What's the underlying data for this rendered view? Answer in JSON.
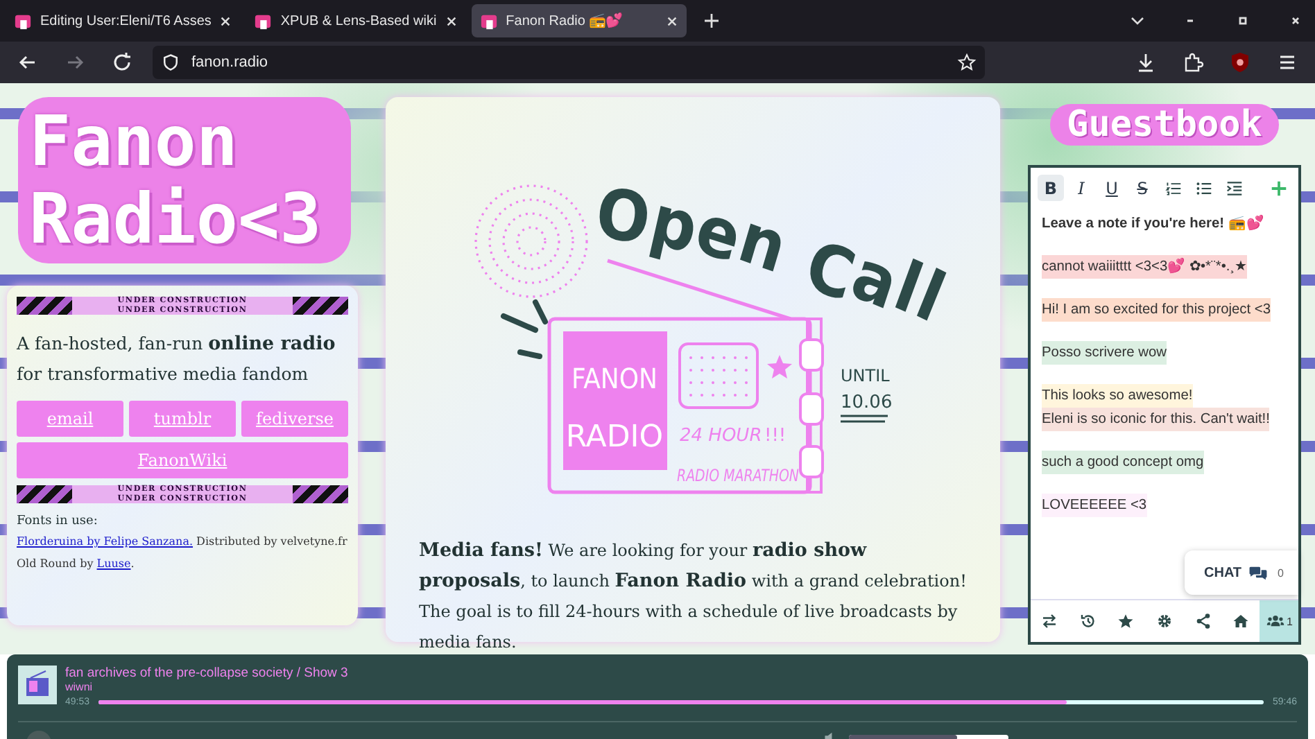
{
  "browser": {
    "tabs": [
      {
        "title": "Editing User:Eleni/T6 Asses",
        "selected": false
      },
      {
        "title": "XPUB & Lens-Based wiki",
        "selected": false
      },
      {
        "title": "Fanon Radio 📻💕",
        "selected": true
      }
    ],
    "forward_disabled": true,
    "address": "fanon.radio"
  },
  "logo": {
    "lines": [
      "Fanon",
      "Radio<3"
    ]
  },
  "about": {
    "banners": [
      {
        "lines": [
          "UNDER CONSTRUCTION",
          "UNDER CONSTRUCTION"
        ]
      },
      {
        "lines": [
          "UNDER CONSTRUCTION",
          "UNDER CONSTRUCTION"
        ]
      }
    ],
    "tagline": "A fan-hosted, fan-run **online radio** for transformative media fandom",
    "links": [
      "email",
      "tumblr",
      "fediverse",
      "FanonWiki"
    ],
    "fonts_heading": "Fonts in use:",
    "credits": [
      [
        {
          "text": "Florderuina by Felipe Sanzana.",
          "kind": "link"
        },
        {
          "text": " Distributed by velvetyne.fr",
          "kind": "text"
        }
      ],
      [
        {
          "text": "Old Round by ",
          "kind": "text"
        },
        {
          "text": "Luuse",
          "kind": "link"
        },
        {
          "text": ".",
          "kind": "text"
        }
      ]
    ]
  },
  "poster": {
    "headline": "Open Call",
    "screen": [
      "FANON",
      "RADIO"
    ],
    "marathon": [
      "24 HOUR",
      "!!!",
      "RADIO MARATHON"
    ],
    "deadline": [
      "UNTIL",
      "10.06"
    ]
  },
  "intro": "**Media fans!** We are looking for your **radio show proposals**, to launch **Fanon Radio** with a grand celebration! The goal is to fill 24-hours with a schedule of live broadcasts by media fans.",
  "guestbook": {
    "title": "Guestbook",
    "tools": [
      {
        "kind": "bold",
        "label": "B",
        "selected": true
      },
      {
        "kind": "italic",
        "label": "I",
        "selected": false
      },
      {
        "kind": "underline",
        "label": "U",
        "selected": false
      },
      {
        "kind": "strike",
        "label": "S",
        "selected": false
      },
      {
        "kind": "ordered-list",
        "selected": false
      },
      {
        "kind": "bullet-list",
        "selected": false
      },
      {
        "kind": "indent",
        "selected": false
      }
    ],
    "notes": [
      {
        "kind": "prompt",
        "lines": [
          {
            "text": "Leave a note if you're here! 📻💕"
          }
        ]
      },
      {
        "kind": "note",
        "lines": [
          {
            "text": "cannot waiiitttt <3<3💕 ✿•*¨*•.¸★",
            "color": "#fbd6d6"
          }
        ]
      },
      {
        "kind": "note",
        "lines": [
          {
            "text": "Hi! I am so excited for this project <3",
            "color": "#fddccb"
          }
        ]
      },
      {
        "kind": "note",
        "lines": [
          {
            "text": "Posso scrivere wow",
            "color": "#dcefe2"
          }
        ]
      },
      {
        "kind": "note",
        "lines": [
          {
            "text": "This looks so awesome!",
            "color": "#fff5dc"
          },
          {
            "text": "Eleni is so iconic for this. Can't wait!!",
            "color": "#f7e1dc"
          }
        ]
      },
      {
        "kind": "note",
        "lines": [
          {
            "text": "such a good concept omg",
            "color": "#dcefe2"
          }
        ]
      },
      {
        "kind": "note",
        "lines": [
          {
            "text": "LOVEEEEEE <3",
            "color": "#fdf0fb"
          }
        ]
      }
    ],
    "chat": {
      "label": "CHAT",
      "count": "0"
    },
    "bottom_tools": [
      {
        "kind": "swap",
        "selected": false
      },
      {
        "kind": "history",
        "selected": false
      },
      {
        "kind": "star",
        "selected": false
      },
      {
        "kind": "settings",
        "selected": false
      },
      {
        "kind": "share",
        "selected": false
      },
      {
        "kind": "home",
        "selected": false
      },
      {
        "kind": "users",
        "count": "1",
        "selected": true
      }
    ]
  },
  "player": {
    "title": "fan archives of the pre-collapse society / Show 3",
    "artist": "wiwni",
    "elapsed": "49:53",
    "total": "59:46",
    "level": 0.83,
    "volume": {
      "level": 0.68
    }
  }
}
